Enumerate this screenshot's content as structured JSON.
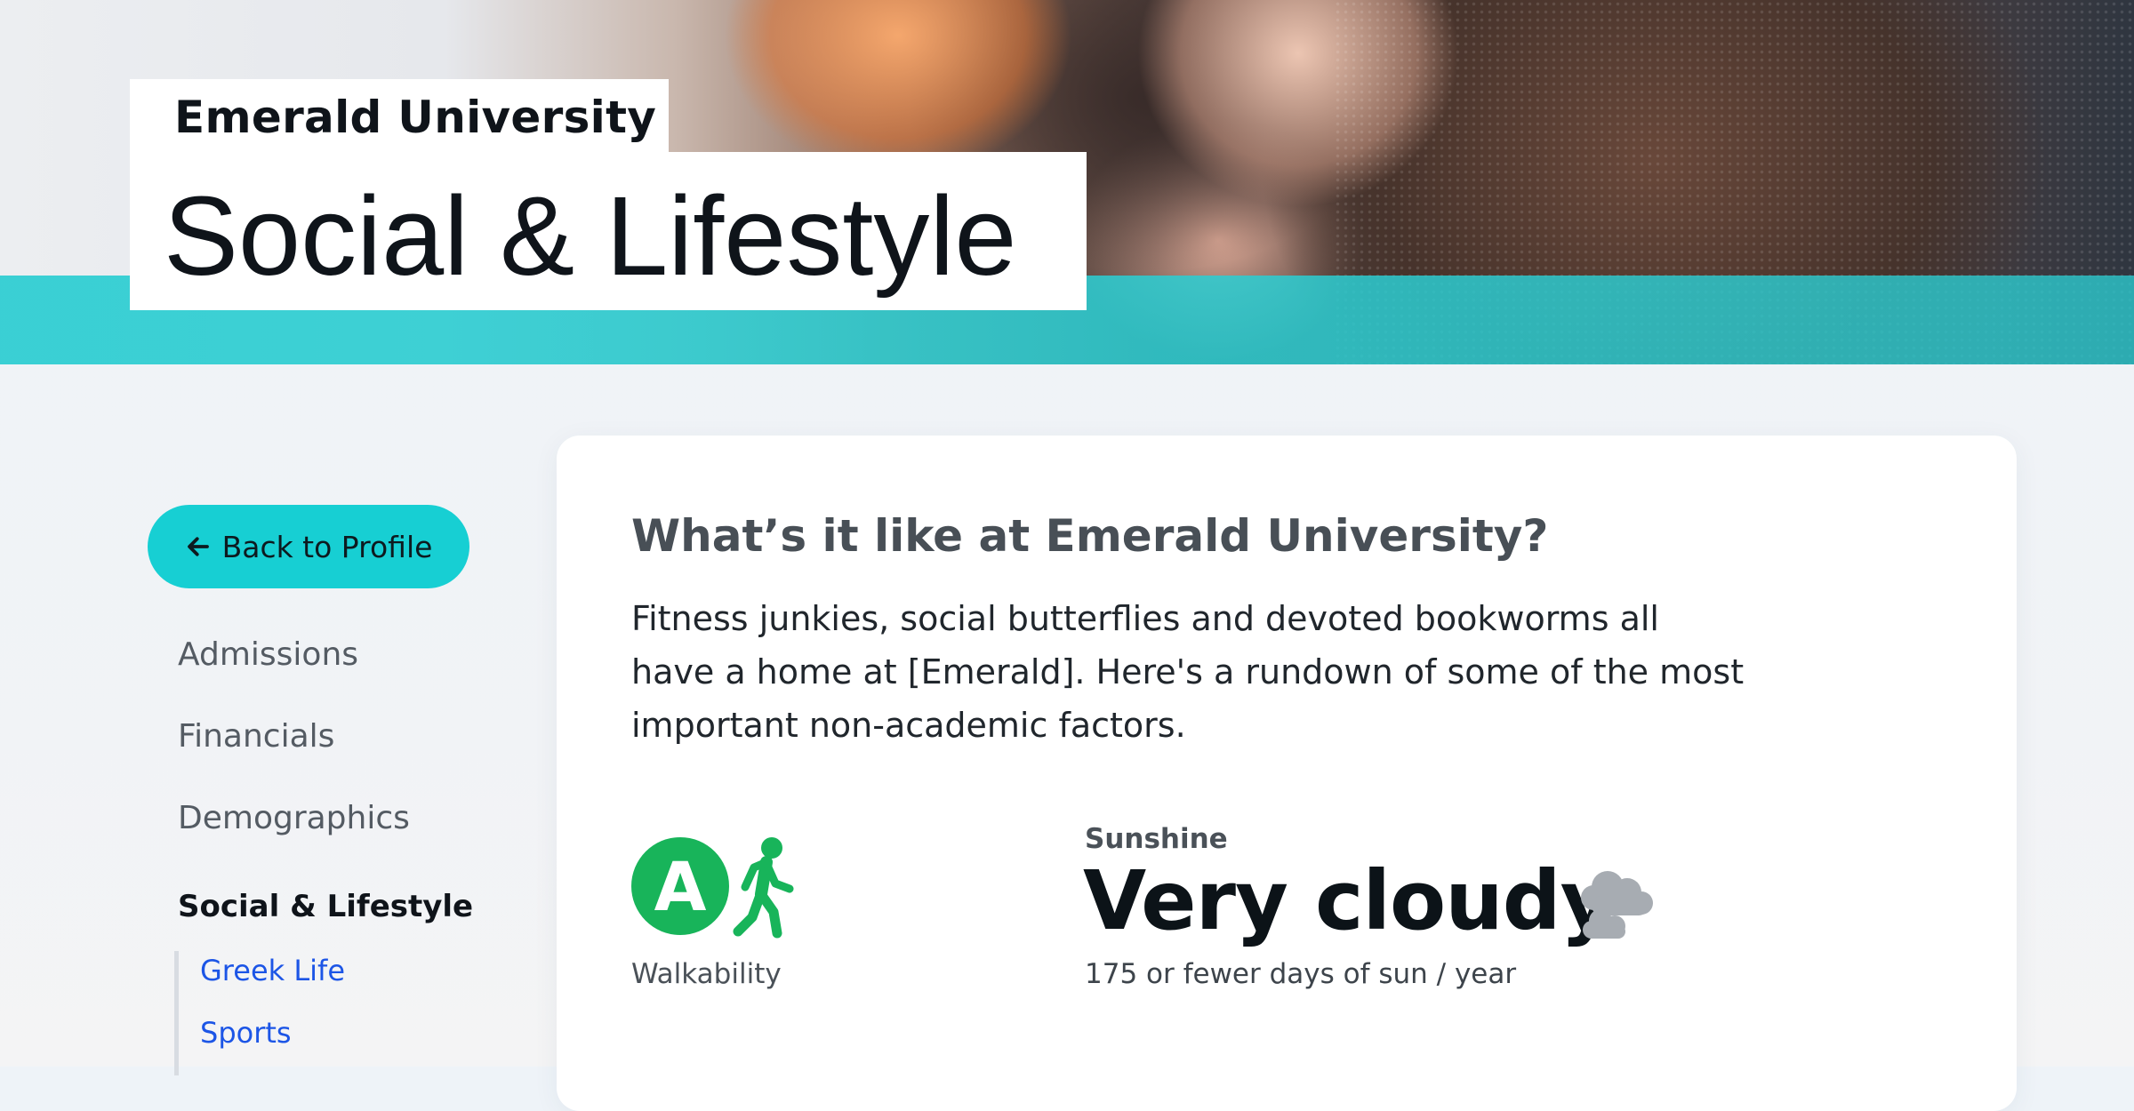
{
  "hero": {
    "university": "Emerald University",
    "title": "Social & Lifestyle"
  },
  "sidebar": {
    "back_label": "Back to Profile",
    "items": [
      {
        "label": "Admissions"
      },
      {
        "label": "Financials"
      },
      {
        "label": "Demographics"
      },
      {
        "label": "Social & Lifestyle",
        "active": true
      }
    ],
    "sub_items": [
      {
        "label": "Greek Life"
      },
      {
        "label": "Sports"
      }
    ]
  },
  "main": {
    "heading": "What’s it like at Emerald University?",
    "intro": "Fitness junkies, social butterflies and devoted bookworms all\nhave a home at [Emerald]. Here's a rundown of some of the most\nimportant non-academic factors.",
    "walkability": {
      "grade": "A",
      "label": "Walkability",
      "icon": "walking-person-icon"
    },
    "sunshine": {
      "label": "Sunshine",
      "value": "Very cloudy",
      "detail": "175 or fewer days of sun / year",
      "icon": "cloud-icon"
    }
  },
  "colors": {
    "accent": "#17cfd3",
    "walk_green": "#18b45a",
    "link": "#1c55e6"
  }
}
